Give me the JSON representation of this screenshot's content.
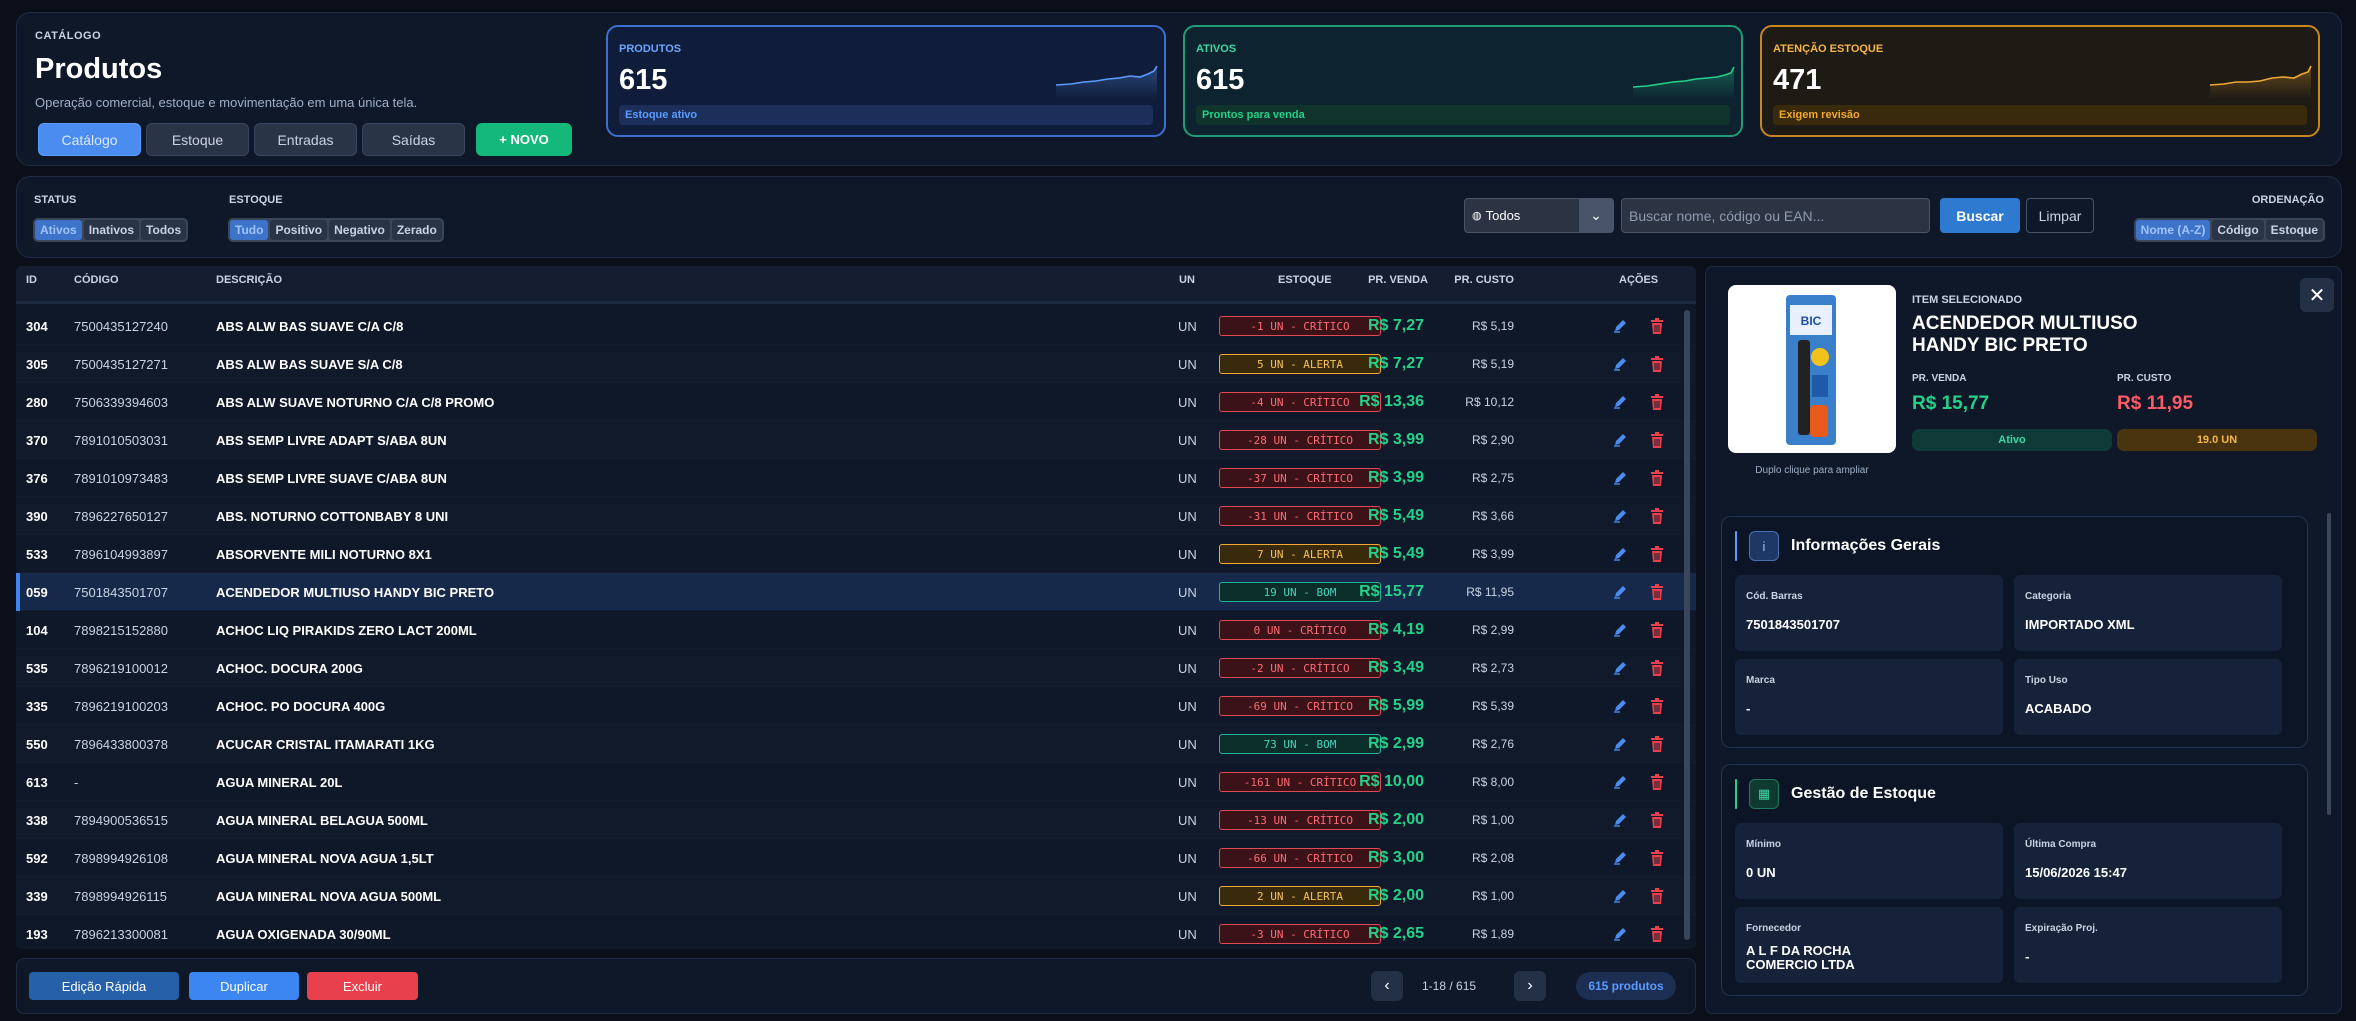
{
  "header": {
    "eyebrow": "CATÁLOGO",
    "title": "Produtos",
    "subtitle": "Operação comercial, estoque e movimentação em uma única tela.",
    "nav": [
      "Catálogo",
      "Estoque",
      "Entradas",
      "Saídas"
    ],
    "active_nav": "Catálogo",
    "new_button": "+ NOVO"
  },
  "kpis": [
    {
      "label": "PRODUTOS",
      "value": "615",
      "footer": "Estoque ativo",
      "color": "#5c9bff"
    },
    {
      "label": "ATIVOS",
      "value": "615",
      "footer": "Prontos para venda",
      "color": "#24d18a"
    },
    {
      "label": "ATENÇÃO ESTOQUE",
      "value": "471",
      "footer": "Exigem revisão",
      "color": "#f0a832"
    }
  ],
  "filters": {
    "status_label": "STATUS",
    "status_options": [
      "Ativos",
      "Inativos",
      "Todos"
    ],
    "status_selected": "Ativos",
    "estoque_label": "ESTOQUE",
    "estoque_options": [
      "Tudo",
      "Positivo",
      "Negativo",
      "Zerado"
    ],
    "estoque_selected": "Tudo",
    "select_value": "Todos",
    "search_placeholder": "Buscar nome, código ou EAN...",
    "search_button": "Buscar",
    "clear_button": "Limpar",
    "sort_label": "ORDENAÇÃO",
    "sort_options": [
      "Nome (A-Z)",
      "Código",
      "Estoque"
    ],
    "sort_selected": "Nome (A-Z)"
  },
  "table": {
    "headers": {
      "id": "ID",
      "code": "CÓDIGO",
      "desc": "DESCRIÇÃO",
      "un": "UN",
      "stock": "ESTOQUE",
      "pv": "PR. VENDA",
      "pc": "PR. CUSTO",
      "actions": "AÇÕES"
    },
    "selected_id": "059",
    "rows": [
      {
        "id": "304",
        "code": "7500435127240",
        "desc": "ABS ALW BAS SUAVE C/A C/8",
        "un": "UN",
        "stock": "-1 UN - CRÍTICO",
        "status": "crit",
        "pv": "R$ 7,27",
        "pc": "R$ 5,19"
      },
      {
        "id": "305",
        "code": "7500435127271",
        "desc": "ABS ALW BAS SUAVE S/A C/8",
        "un": "UN",
        "stock": "5 UN - ALERTA",
        "status": "alert",
        "pv": "R$ 7,27",
        "pc": "R$ 5,19"
      },
      {
        "id": "280",
        "code": "7506339394603",
        "desc": "ABS ALW SUAVE NOTURNO C/A C/8 PROMO",
        "un": "UN",
        "stock": "-4 UN - CRÍTICO",
        "status": "crit",
        "pv": "R$ 13,36",
        "pc": "R$ 10,12"
      },
      {
        "id": "370",
        "code": "7891010503031",
        "desc": "ABS SEMP LIVRE ADAPT S/ABA 8UN",
        "un": "UN",
        "stock": "-28 UN - CRÍTICO",
        "status": "crit",
        "pv": "R$ 3,99",
        "pc": "R$ 2,90"
      },
      {
        "id": "376",
        "code": "7891010973483",
        "desc": "ABS SEMP LIVRE SUAVE C/ABA 8UN",
        "un": "UN",
        "stock": "-37 UN - CRÍTICO",
        "status": "crit",
        "pv": "R$ 3,99",
        "pc": "R$ 2,75"
      },
      {
        "id": "390",
        "code": "7896227650127",
        "desc": "ABS. NOTURNO COTTONBABY 8 UNI",
        "un": "UN",
        "stock": "-31 UN - CRÍTICO",
        "status": "crit",
        "pv": "R$ 5,49",
        "pc": "R$ 3,66"
      },
      {
        "id": "533",
        "code": "7896104993897",
        "desc": "ABSORVENTE MILI NOTURNO 8X1",
        "un": "UN",
        "stock": "7 UN - ALERTA",
        "status": "alert",
        "pv": "R$ 5,49",
        "pc": "R$ 3,99"
      },
      {
        "id": "059",
        "code": "7501843501707",
        "desc": "ACENDEDOR MULTIUSO HANDY BIC PRETO",
        "un": "UN",
        "stock": "19 UN - BOM",
        "status": "good",
        "pv": "R$ 15,77",
        "pc": "R$ 11,95"
      },
      {
        "id": "104",
        "code": "7898215152880",
        "desc": "ACHOC LIQ PIRAKIDS ZERO LACT 200ML",
        "un": "UN",
        "stock": "0 UN - CRÍTICO",
        "status": "crit",
        "pv": "R$ 4,19",
        "pc": "R$ 2,99"
      },
      {
        "id": "535",
        "code": "7896219100012",
        "desc": "ACHOC. DOCURA 200G",
        "un": "UN",
        "stock": "-2 UN - CRÍTICO",
        "status": "crit",
        "pv": "R$ 3,49",
        "pc": "R$ 2,73"
      },
      {
        "id": "335",
        "code": "7896219100203",
        "desc": "ACHOC. PO DOCURA 400G",
        "un": "UN",
        "stock": "-69 UN - CRÍTICO",
        "status": "crit",
        "pv": "R$ 5,99",
        "pc": "R$ 5,39"
      },
      {
        "id": "550",
        "code": "7896433800378",
        "desc": "ACUCAR CRISTAL ITAMARATI 1KG",
        "un": "UN",
        "stock": "73 UN - BOM",
        "status": "good",
        "pv": "R$ 2,99",
        "pc": "R$ 2,76"
      },
      {
        "id": "613",
        "code": "-",
        "desc": "AGUA MINERAL 20L",
        "un": "UN",
        "stock": "-161 UN - CRÍTICO",
        "status": "crit",
        "pv": "R$ 10,00",
        "pc": "R$ 8,00"
      },
      {
        "id": "338",
        "code": "7894900536515",
        "desc": "AGUA MINERAL BELAGUA 500ML",
        "un": "UN",
        "stock": "-13 UN - CRÍTICO",
        "status": "crit",
        "pv": "R$ 2,00",
        "pc": "R$ 1,00"
      },
      {
        "id": "592",
        "code": "7898994926108",
        "desc": "AGUA MINERAL NOVA AGUA 1,5LT",
        "un": "UN",
        "stock": "-66 UN - CRÍTICO",
        "status": "crit",
        "pv": "R$ 3,00",
        "pc": "R$ 2,08"
      },
      {
        "id": "339",
        "code": "7898994926115",
        "desc": "AGUA MINERAL NOVA AGUA 500ML",
        "un": "UN",
        "stock": "2 UN - ALERTA",
        "status": "alert",
        "pv": "R$ 2,00",
        "pc": "R$ 1,00"
      },
      {
        "id": "193",
        "code": "7896213300081",
        "desc": "AGUA OXIGENADA 30/90ML",
        "un": "UN",
        "stock": "-3 UN - CRÍTICO",
        "status": "crit",
        "pv": "R$ 2,65",
        "pc": "R$ 1,89"
      }
    ]
  },
  "footer": {
    "quick_edit": "Edição Rápida",
    "duplicate": "Duplicar",
    "delete": "Excluir",
    "page_info": "1-18 / 615",
    "count": "615 produtos"
  },
  "detail": {
    "img_hint": "Duplo clique para ampliar",
    "eyebrow": "ITEM SELECIONADO",
    "name": "ACENDEDOR MULTIUSO HANDY BIC PRETO",
    "pv_label": "PR. VENDA",
    "pv": "R$ 15,77",
    "pc_label": "PR. CUSTO",
    "pc": "R$ 11,95",
    "status": "Ativo",
    "stock": "19.0 UN",
    "info_title": "Informações Gerais",
    "info": [
      {
        "label": "Cód. Barras",
        "value": "7501843501707"
      },
      {
        "label": "Categoria",
        "value": "IMPORTADO XML"
      },
      {
        "label": "Marca",
        "value": "-"
      },
      {
        "label": "Tipo Uso",
        "value": "ACABADO"
      }
    ],
    "stock_title": "Gestão de Estoque",
    "stock_cells": [
      {
        "label": "Mínimo",
        "value": "0 UN"
      },
      {
        "label": "Última Compra",
        "value": "15/06/2026 15:47"
      },
      {
        "label": "Fornecedor",
        "value": "A L F DA ROCHA COMERCIO LTDA"
      },
      {
        "label": "Expiração Proj.",
        "value": "-"
      }
    ]
  }
}
